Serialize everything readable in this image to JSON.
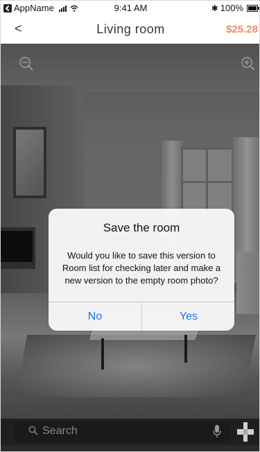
{
  "status_bar": {
    "app_name": "AppName",
    "time": "9:41 AM",
    "battery": "100%"
  },
  "nav": {
    "back_label": "<",
    "title": "Living room",
    "price": "$25.28"
  },
  "alert": {
    "title": "Save the room",
    "message": "Would you like to save this version  to Room list for checking later and make a new version to the empty room photo?",
    "no_label": "No",
    "yes_label": "Yes"
  },
  "search": {
    "placeholder": "Search"
  },
  "colors": {
    "price": "#f08a6c",
    "alert_button": "#1a73e8",
    "search_bar_bg": "#1f1f1f"
  }
}
